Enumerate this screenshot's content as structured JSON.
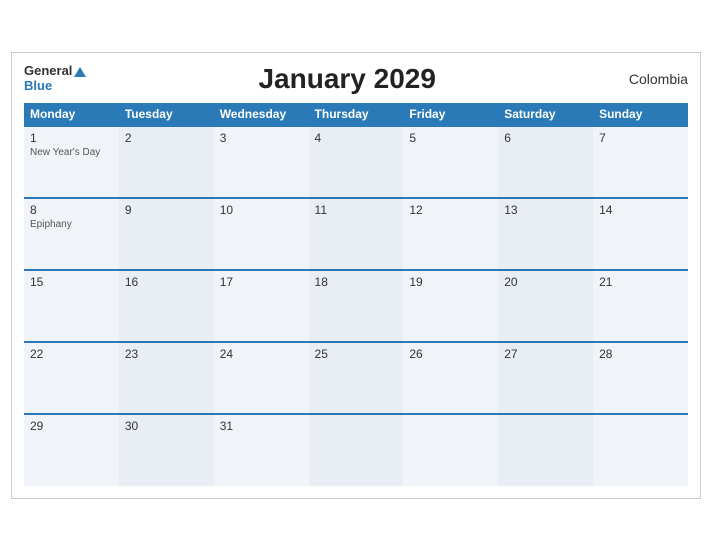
{
  "header": {
    "title": "January 2029",
    "country": "Colombia",
    "logo_general": "General",
    "logo_blue": "Blue"
  },
  "weekdays": [
    "Monday",
    "Tuesday",
    "Wednesday",
    "Thursday",
    "Friday",
    "Saturday",
    "Sunday"
  ],
  "weeks": [
    [
      {
        "day": "1",
        "holiday": "New Year's Day"
      },
      {
        "day": "2",
        "holiday": ""
      },
      {
        "day": "3",
        "holiday": ""
      },
      {
        "day": "4",
        "holiday": ""
      },
      {
        "day": "5",
        "holiday": ""
      },
      {
        "day": "6",
        "holiday": ""
      },
      {
        "day": "7",
        "holiday": ""
      }
    ],
    [
      {
        "day": "8",
        "holiday": "Epiphany"
      },
      {
        "day": "9",
        "holiday": ""
      },
      {
        "day": "10",
        "holiday": ""
      },
      {
        "day": "11",
        "holiday": ""
      },
      {
        "day": "12",
        "holiday": ""
      },
      {
        "day": "13",
        "holiday": ""
      },
      {
        "day": "14",
        "holiday": ""
      }
    ],
    [
      {
        "day": "15",
        "holiday": ""
      },
      {
        "day": "16",
        "holiday": ""
      },
      {
        "day": "17",
        "holiday": ""
      },
      {
        "day": "18",
        "holiday": ""
      },
      {
        "day": "19",
        "holiday": ""
      },
      {
        "day": "20",
        "holiday": ""
      },
      {
        "day": "21",
        "holiday": ""
      }
    ],
    [
      {
        "day": "22",
        "holiday": ""
      },
      {
        "day": "23",
        "holiday": ""
      },
      {
        "day": "24",
        "holiday": ""
      },
      {
        "day": "25",
        "holiday": ""
      },
      {
        "day": "26",
        "holiday": ""
      },
      {
        "day": "27",
        "holiday": ""
      },
      {
        "day": "28",
        "holiday": ""
      }
    ],
    [
      {
        "day": "29",
        "holiday": ""
      },
      {
        "day": "30",
        "holiday": ""
      },
      {
        "day": "31",
        "holiday": ""
      },
      {
        "day": "",
        "holiday": ""
      },
      {
        "day": "",
        "holiday": ""
      },
      {
        "day": "",
        "holiday": ""
      },
      {
        "day": "",
        "holiday": ""
      }
    ]
  ]
}
